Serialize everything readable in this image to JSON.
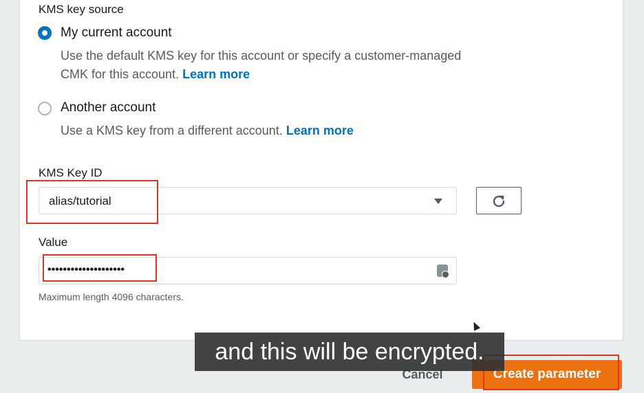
{
  "kms_source": {
    "label": "KMS key source",
    "options": [
      {
        "title": "My current account",
        "description": "Use the default KMS key for this account or specify a customer-managed CMK for this account.",
        "link": "Learn more",
        "selected": true
      },
      {
        "title": "Another account",
        "description": "Use a KMS key from a different account.",
        "link": "Learn more",
        "selected": false
      }
    ]
  },
  "kms_key_id": {
    "label": "KMS Key ID",
    "value": "alias/tutorial",
    "refresh_icon": "refresh-icon"
  },
  "value_field": {
    "label": "Value",
    "masked_value": "••••••••••••••••••••",
    "icon": "key-icon",
    "hint": "Maximum length 4096 characters."
  },
  "footer": {
    "cancel_label": "Cancel",
    "create_label": "Create parameter"
  },
  "caption": "and this will be encrypted.",
  "colors": {
    "accent": "#0073bb",
    "primary_button": "#ec7211",
    "highlight": "#e8331b"
  }
}
